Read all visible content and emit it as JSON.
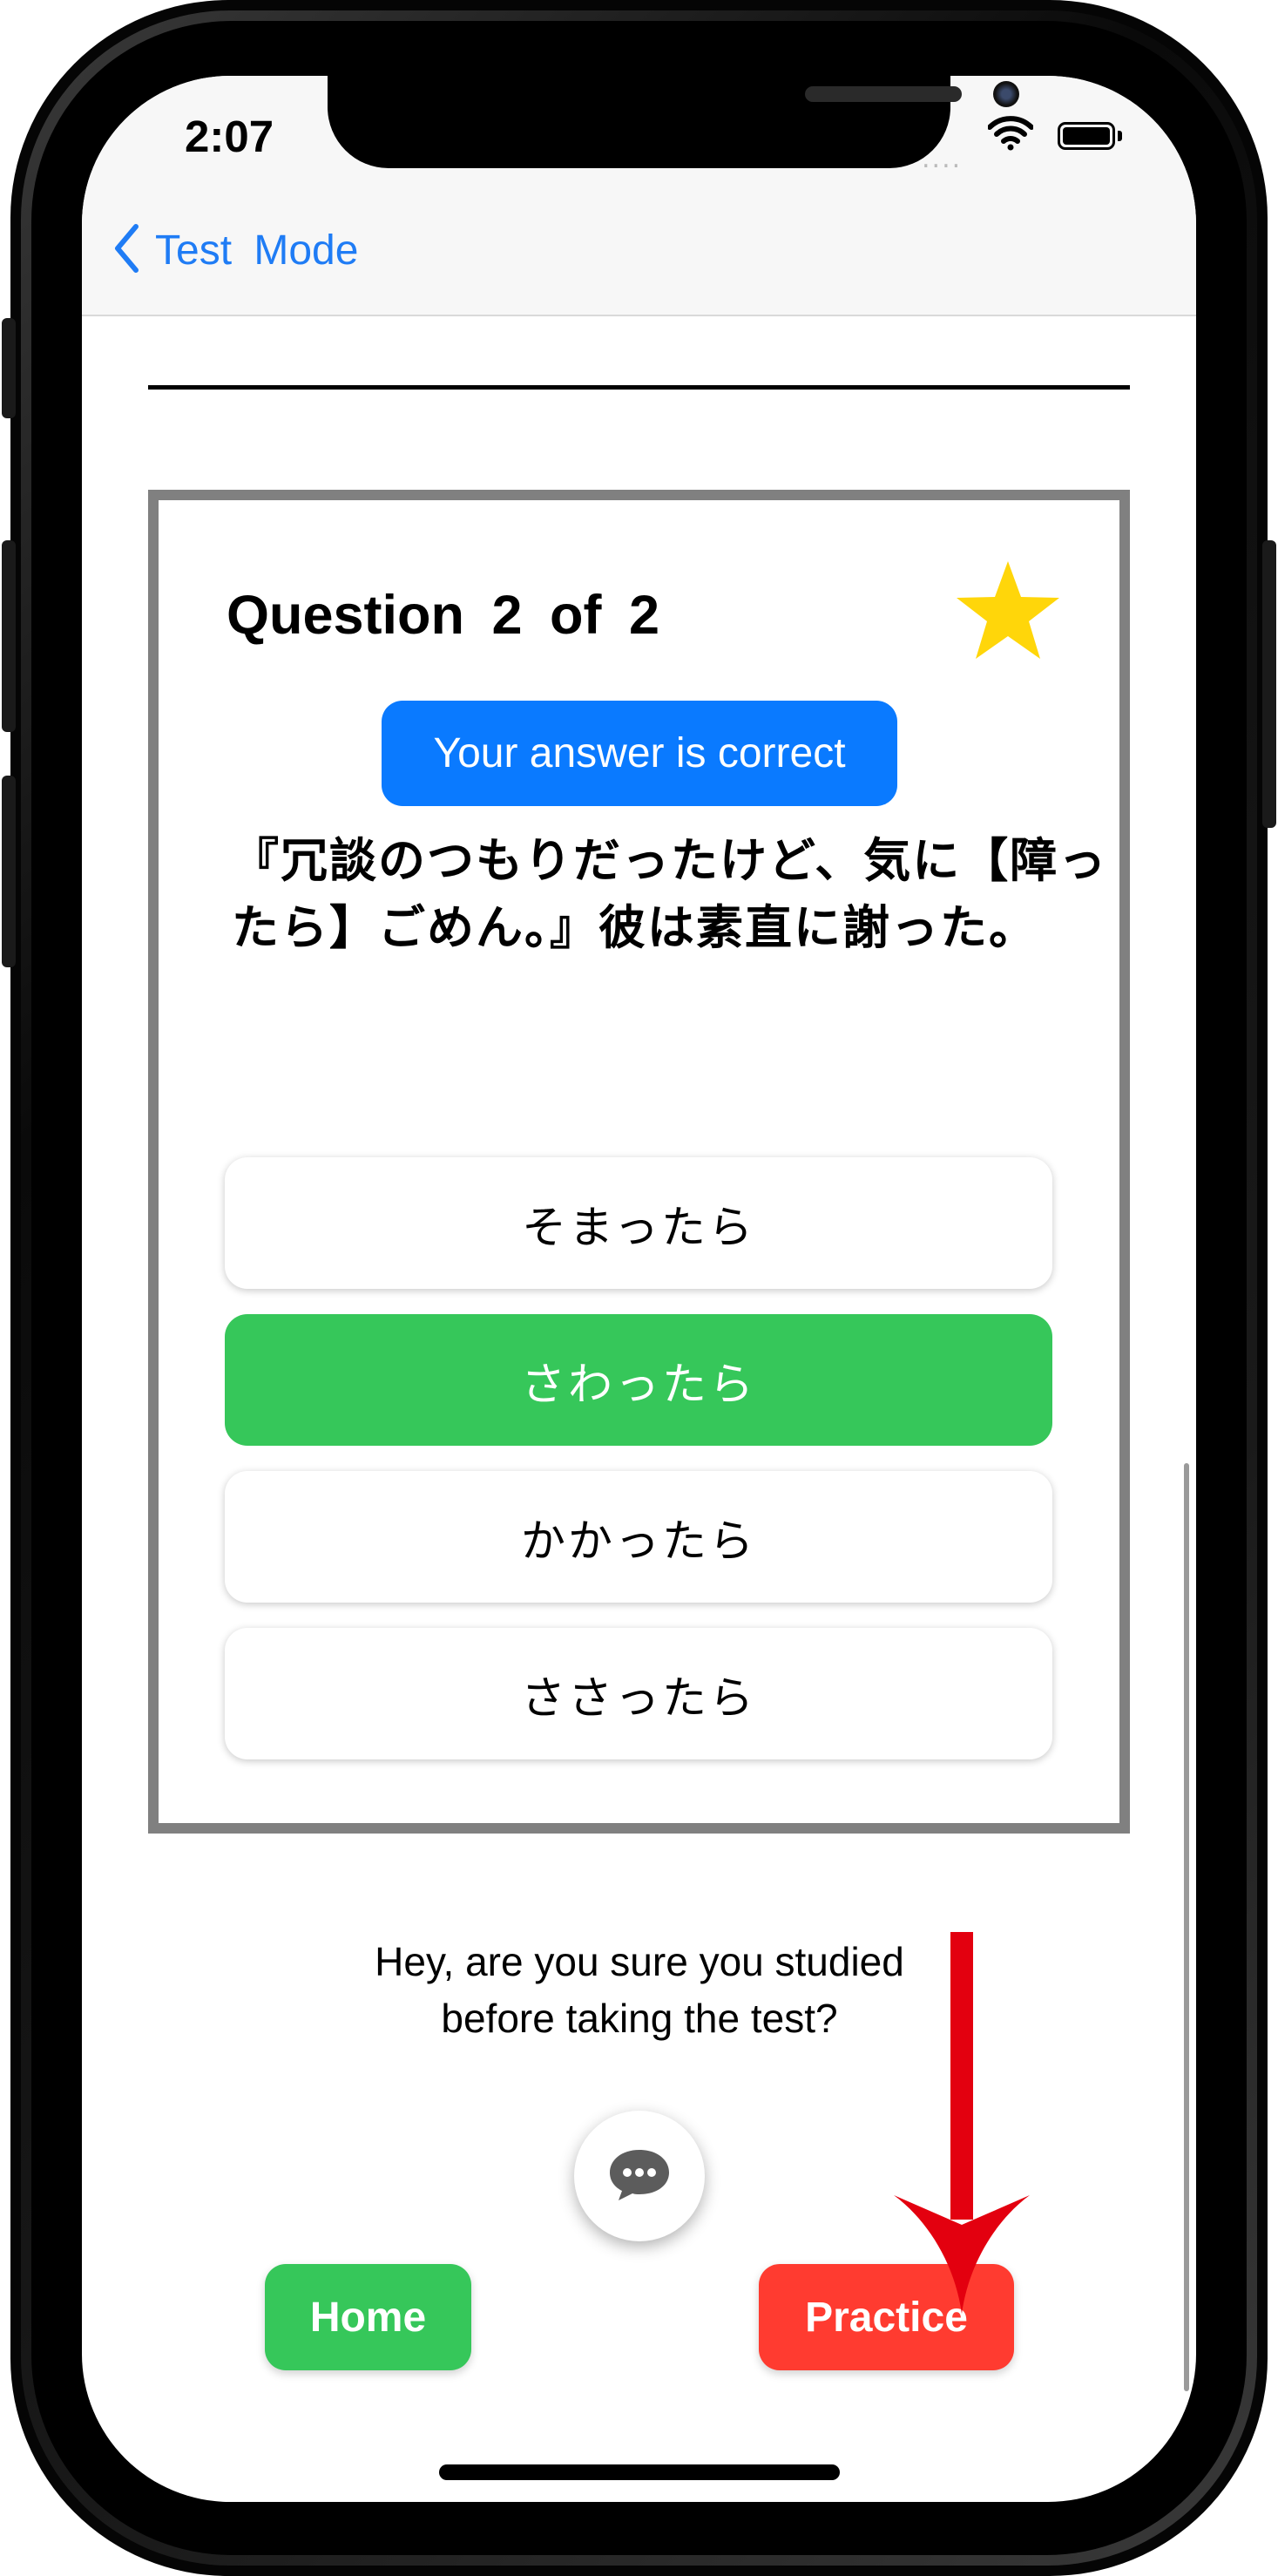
{
  "status_bar": {
    "time": "2:07",
    "signal": "....",
    "icons": [
      "wifi-icon",
      "battery-icon"
    ]
  },
  "nav": {
    "back_label": "Test  Mode",
    "back_icon": "chevron-left-icon"
  },
  "card": {
    "title": "Question  2  of  2",
    "star_icon": "star-icon",
    "result_badge": "Your answer is correct",
    "question": "『冗談のつもりだったけど、気に【障ったら】ごめん。』彼は素直に謝った。",
    "options": [
      {
        "label": "そまったら",
        "state": "default"
      },
      {
        "label": "さわったら",
        "state": "correct"
      },
      {
        "label": "かかったら",
        "state": "default"
      },
      {
        "label": "ささったら",
        "state": "default"
      }
    ]
  },
  "note_lines": [
    "Hey, are you sure you studied",
    "before taking the test?"
  ],
  "chat_icon": "chat-bubble-icon",
  "buttons": {
    "home": "Home",
    "practice": "Practice"
  },
  "annotation": {
    "arrow_icon": "red-down-arrow-icon"
  },
  "colors": {
    "accent_blue": "#0a7aff",
    "link_blue": "#1f7cf5",
    "correct_green": "#36c75a",
    "practice_red": "#ff3b30",
    "star_yellow": "#ffd60a",
    "card_border": "#808080",
    "arrow_red": "#e3000f"
  }
}
